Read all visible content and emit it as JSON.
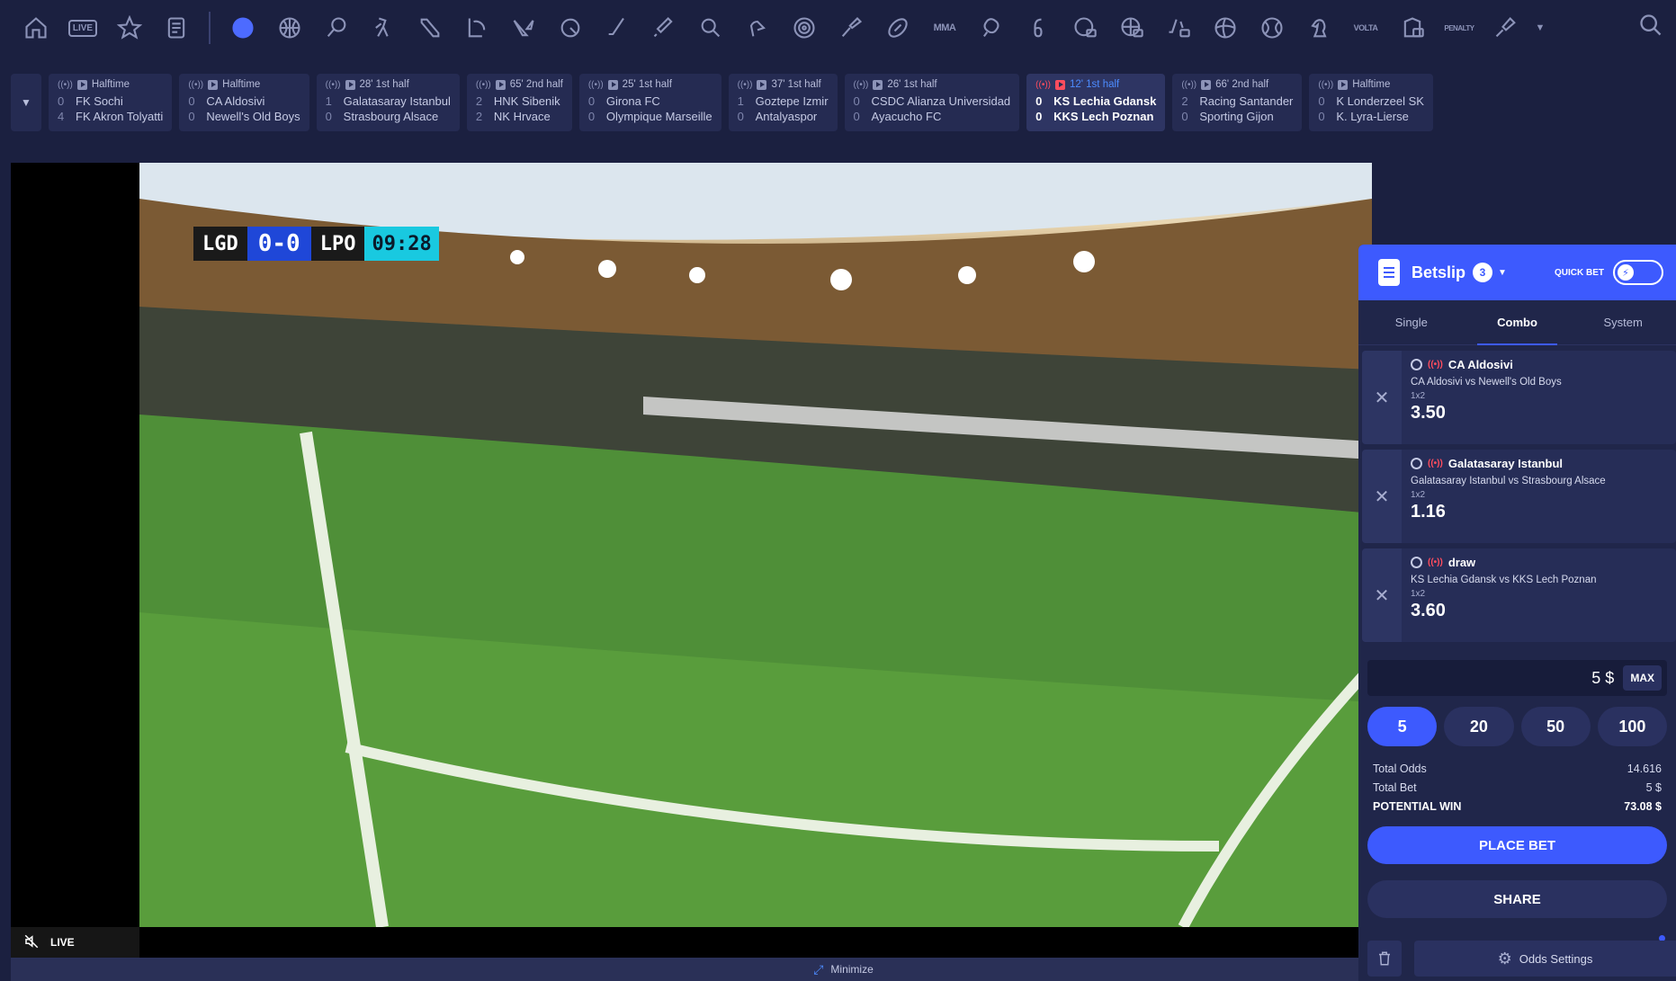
{
  "nav": {
    "live_label": "LIVE",
    "mma_label": "MMA",
    "volta_label": "VOLTA",
    "penalty_label": "PENALTY"
  },
  "matches": [
    {
      "status": "Halftime",
      "home": "FK Sochi",
      "away": "FK Akron Tolyatti",
      "home_score": "0",
      "away_score": "4",
      "active": false
    },
    {
      "status": "Halftime",
      "home": "CA Aldosivi",
      "away": "Newell's Old Boys",
      "home_score": "0",
      "away_score": "0",
      "active": false
    },
    {
      "status": "28' 1st half",
      "home": "Galatasaray Istanbul",
      "away": "Strasbourg Alsace",
      "home_score": "1",
      "away_score": "0",
      "active": false
    },
    {
      "status": "65' 2nd half",
      "home": "HNK Sibenik",
      "away": "NK Hrvace",
      "home_score": "2",
      "away_score": "2",
      "active": false
    },
    {
      "status": "25' 1st half",
      "home": "Girona FC",
      "away": "Olympique Marseille",
      "home_score": "0",
      "away_score": "0",
      "active": false
    },
    {
      "status": "37' 1st half",
      "home": "Goztepe Izmir",
      "away": "Antalyaspor",
      "home_score": "1",
      "away_score": "0",
      "active": false
    },
    {
      "status": "26' 1st half",
      "home": "CSDC Alianza Universidad",
      "away": "Ayacucho FC",
      "home_score": "0",
      "away_score": "0",
      "active": false
    },
    {
      "status": "12' 1st half",
      "home": "KS Lechia Gdansk",
      "away": "KKS Lech Poznan",
      "home_score": "0",
      "away_score": "0",
      "active": true
    },
    {
      "status": "66' 2nd half",
      "home": "Racing Santander",
      "away": "Sporting Gijon",
      "home_score": "2",
      "away_score": "0",
      "active": false
    },
    {
      "status": "Halftime",
      "home": "K Londerzeel SK",
      "away": "K. Lyra-Lierse",
      "home_score": "0",
      "away_score": "0",
      "active": false
    }
  ],
  "scoreboard": {
    "home": "LGD",
    "score": "0-0",
    "away": "LPO",
    "time": "09:28"
  },
  "video": {
    "live_label": "LIVE",
    "minimize_label": "Minimize"
  },
  "betslip": {
    "title": "Betslip",
    "count": "3",
    "quick_bet_label": "QUICK BET",
    "tabs": [
      "Single",
      "Combo",
      "System"
    ],
    "active_tab": "Combo",
    "bets": [
      {
        "selection": "CA Aldosivi",
        "match": "CA Aldosivi vs Newell's Old Boys",
        "market": "1x2",
        "odds": "3.50"
      },
      {
        "selection": "Galatasaray Istanbul",
        "match": "Galatasaray Istanbul vs Strasbourg Alsace",
        "market": "1x2",
        "odds": "1.16"
      },
      {
        "selection": "draw",
        "match": "KS Lechia Gdansk vs KKS Lech Poznan",
        "market": "1x2",
        "odds": "3.60"
      }
    ],
    "stake": "5 $",
    "max_label": "MAX",
    "quick_stakes": [
      "5",
      "20",
      "50",
      "100"
    ],
    "totals": {
      "total_odds_label": "Total Odds",
      "total_odds": "14.616",
      "total_bet_label": "Total Bet",
      "total_bet": "5 $",
      "potential_win_label": "POTENTIAL WIN",
      "potential_win": "73.08 $"
    },
    "place_bet_label": "PLACE BET",
    "share_label": "SHARE",
    "odds_settings_label": "Odds Settings"
  },
  "colors": {
    "accent": "#3d5afe",
    "live_red": "#ff4d5e",
    "background": "#1b2040"
  }
}
